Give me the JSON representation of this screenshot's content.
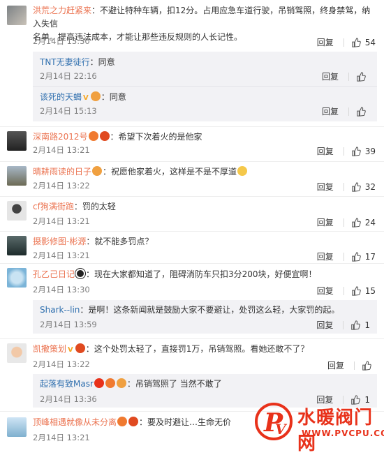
{
  "comments": [
    {
      "user": "洪荒之力赶紧来",
      "text": "：不避让特种车辆，扣12分。占用应急车道行驶，吊销驾照，终身禁驾，纳入失信",
      "text2": "名单。提高违法成本，才能让那些违反规则的人长记性。",
      "time": "2月14日 13:30",
      "reply": "回复",
      "likes": "54"
    },
    {
      "user": "深南路2012号",
      "text": "：希望下次着火的是他家",
      "time": "2月14日 13:21",
      "reply": "回复",
      "likes": "39"
    },
    {
      "user": "晴耕雨读的日子",
      "text": "：祝愿他家着火，这样是不是不厚道",
      "time": "2月14日 13:22",
      "reply": "回复",
      "likes": "32"
    },
    {
      "user": "cf狗满街跑",
      "text": "：罚的太轻",
      "time": "2月14日 13:21",
      "reply": "回复",
      "likes": "24"
    },
    {
      "user": "摄影修图-彬源",
      "text": "：就不能多罚点？",
      "time": "2月14日 13:21",
      "reply": "回复",
      "likes": "17"
    },
    {
      "user": "孔乙己日记",
      "text": "：现在大家都知道了，阻碍消防车只扣3分200块，好便宜啊！",
      "time": "2月14日 13:30",
      "reply": "回复",
      "likes": "15"
    },
    {
      "user": "凯撒策划",
      "text": "：这个处罚太轻了，直接罚1万，吊销驾照。看她还敢不了？",
      "time": "2月14日 13:22",
      "reply": "回复",
      "likes": ""
    },
    {
      "user": "顶峰相遇就像从未分离",
      "text": "：要及时避让…生命无价",
      "time": "2月14日 13:21",
      "reply": "回复",
      "likes": ""
    }
  ],
  "subs": [
    {
      "user": "TNT无妻徒行",
      "text": "：同意",
      "time": "2月14日 22:16",
      "reply": "回复",
      "likes": ""
    },
    {
      "user": "该死的天蝎",
      "text": "：同意",
      "time": "2月14日 15:13",
      "reply": "回复",
      "likes": ""
    },
    {
      "user": "Shark--lin",
      "text": "：是啊！这条新闻就是鼓励大家不要避让，处罚这么轻，大家罚的起。",
      "time": "2月14日 13:59",
      "reply": "回复",
      "likes": "1"
    },
    {
      "user": "起落有致Masr",
      "text": "：吊销驾照了   当然不敢了",
      "time": "2月14日 13:36",
      "reply": "回复",
      "likes": "1"
    }
  ],
  "watermark": {
    "title": "水暖阀门网",
    "url": "WWW.PVCPU.COM"
  },
  "colors": {
    "user": "#eb7350",
    "sub_user": "#2f6fae",
    "sub_bg": "#f2f2f5",
    "watermark": "#e8311a"
  }
}
